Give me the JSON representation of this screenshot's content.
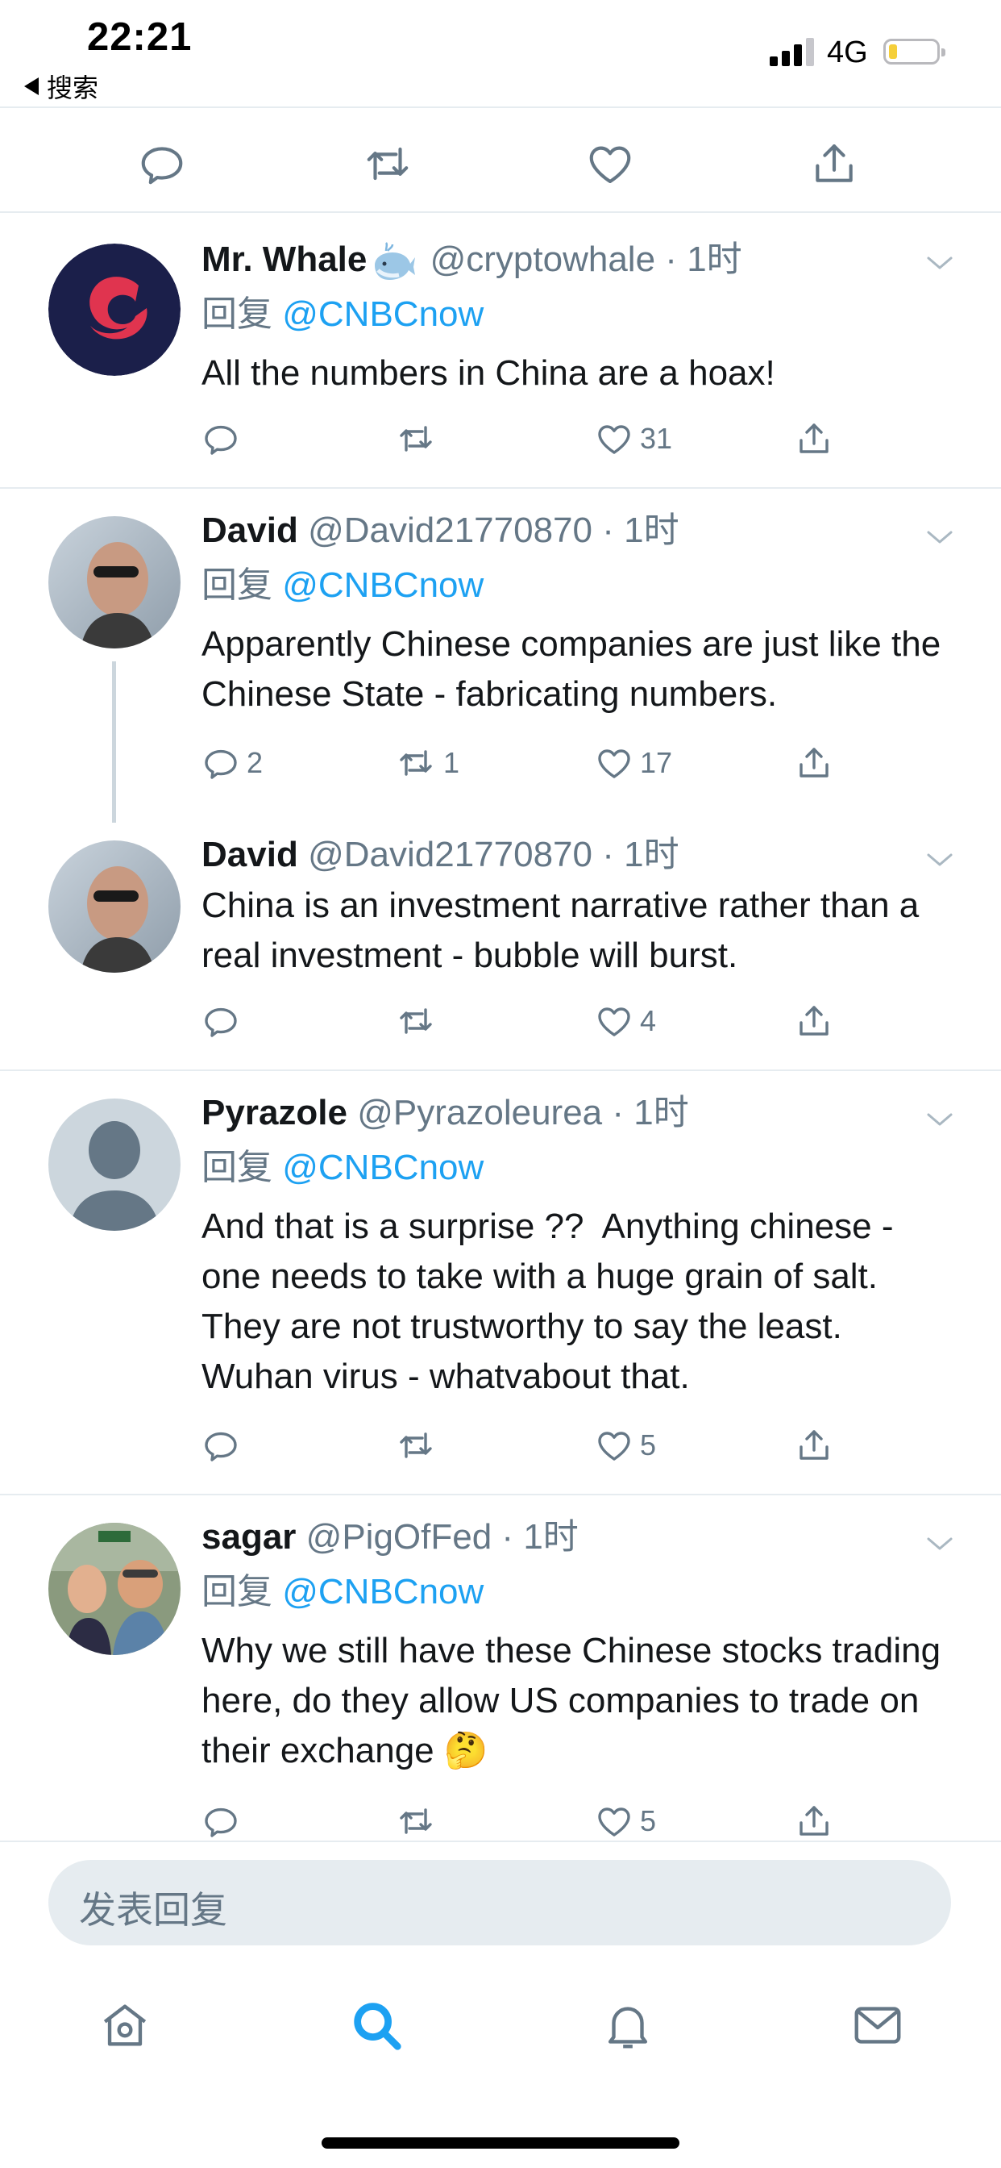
{
  "status_bar": {
    "time": "22:21",
    "back_label": "搜索",
    "network": "4G"
  },
  "colors": {
    "link": "#1da1f2",
    "secondary_text": "#657786",
    "divider": "#e6ecf0",
    "battery": "#f5cf3a"
  },
  "top_actions": [
    "reply-icon",
    "retweet-icon",
    "like-icon",
    "share-icon"
  ],
  "tweets": [
    {
      "name": "Mr. Whale",
      "handle": "@cryptowhale",
      "time": "1时",
      "reply_prefix": "回复",
      "reply_to": "@CNBCnow",
      "text": "All the numbers in China are a hoax!",
      "replies": "",
      "retweets": "",
      "likes": "31"
    },
    {
      "name": "David",
      "handle": "@David21770870",
      "time": "1时",
      "reply_prefix": "回复",
      "reply_to": "@CNBCnow",
      "text": "Apparently Chinese companies are just like the Chinese State - fabricating numbers.",
      "replies": "2",
      "retweets": "1",
      "likes": "17"
    },
    {
      "name": "David",
      "handle": "@David21770870",
      "time": "1时",
      "text": "China is an investment narrative rather than a real investment - bubble will burst.",
      "replies": "",
      "retweets": "",
      "likes": "4"
    },
    {
      "name": "Pyrazole",
      "handle": "@Pyrazoleurea",
      "time": "1时",
      "reply_prefix": "回复",
      "reply_to": "@CNBCnow",
      "text": "And that is a surprise ??  Anything chinese - one needs to take with a huge grain of salt.  They are not trustworthy to say the least.  Wuhan virus - whatvabout that.",
      "replies": "",
      "retweets": "",
      "likes": "5"
    },
    {
      "name": "sagar",
      "handle": "@PigOfFed",
      "time": "1时",
      "reply_prefix": "回复",
      "reply_to": "@CNBCnow",
      "text": "Why we still have these Chinese stocks trading here, do they allow US companies to trade on their exchange 🤔",
      "replies": "",
      "retweets": "",
      "likes": "5"
    }
  ],
  "composer": {
    "placeholder": "发表回复"
  },
  "tab_bar": [
    "home-icon",
    "search-icon",
    "notifications-icon",
    "messages-icon"
  ],
  "separator": "·"
}
